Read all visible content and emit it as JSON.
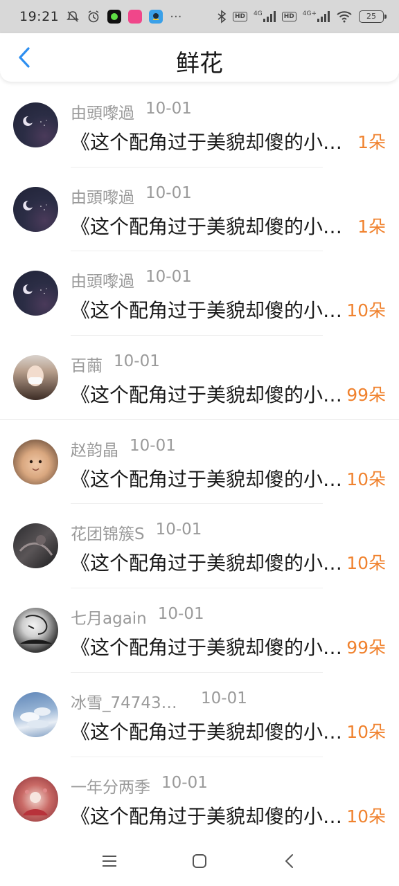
{
  "status_bar": {
    "time": "19:21",
    "network_1": "4G",
    "network_2": "4G+",
    "hd_1": "HD",
    "hd_2": "HD",
    "battery": "25",
    "icons": [
      "mute-icon",
      "alarm-icon",
      "app-icon-green",
      "app-icon-pink",
      "app-icon-blue",
      "more-dots-icon",
      "bluetooth-icon",
      "signal-icon",
      "wifi-icon",
      "battery-icon"
    ]
  },
  "header": {
    "title": "鲜花",
    "back_icon": "chevron-left-icon",
    "accent_color": "#2e8ff0"
  },
  "colors": {
    "count_color": "#f0822e",
    "meta_color": "#9a9a9a",
    "text_color": "#1a1a1a"
  },
  "items": [
    {
      "name": "由頭嚟過",
      "date": "10-01",
      "message": "《这个配角过于美貌却傻的小说》",
      "count": "1朵",
      "avatar": "night-sky-avatar"
    },
    {
      "name": "由頭嚟過",
      "date": "10-01",
      "message": "《这个配角过于美貌却傻的小说》",
      "count": "1朵",
      "avatar": "night-sky-avatar"
    },
    {
      "name": "由頭嚟過",
      "date": "10-01",
      "message": "《这个配角过于美貌却傻的小说》",
      "count": "10朵",
      "avatar": "night-sky-avatar"
    },
    {
      "name": "百繭",
      "date": "10-01",
      "message": "《这个配角过于美貌却傻的小说》",
      "count": "99朵",
      "avatar": "girl-mask-avatar"
    },
    {
      "name": "赵韵晶",
      "date": "10-01",
      "message": "《这个配角过于美貌却傻的小说》",
      "count": "10朵",
      "avatar": "baby-avatar"
    },
    {
      "name": "花团锦簇S",
      "date": "10-01",
      "message": "《这个配角过于美貌却傻的小说》",
      "count": "10朵",
      "avatar": "dark-photo-avatar"
    },
    {
      "name": "七月again",
      "date": "10-01",
      "message": "《这个配角过于美貌却傻的小说》",
      "count": "99朵",
      "avatar": "sketch-avatar"
    },
    {
      "name": "冰雪_74743…",
      "date": "10-01",
      "message": "《这个配角过于美貌却傻的小说》",
      "count": "10朵",
      "avatar": "sky-clouds-avatar"
    },
    {
      "name": "一年分两季",
      "date": "10-01",
      "message": "《这个配角过于美貌却傻的小说》",
      "count": "10朵",
      "avatar": "red-flower-avatar"
    }
  ],
  "nav": {
    "menu_icon": "menu-icon",
    "home_icon": "home-square-icon",
    "back_icon": "back-chevron-icon"
  }
}
